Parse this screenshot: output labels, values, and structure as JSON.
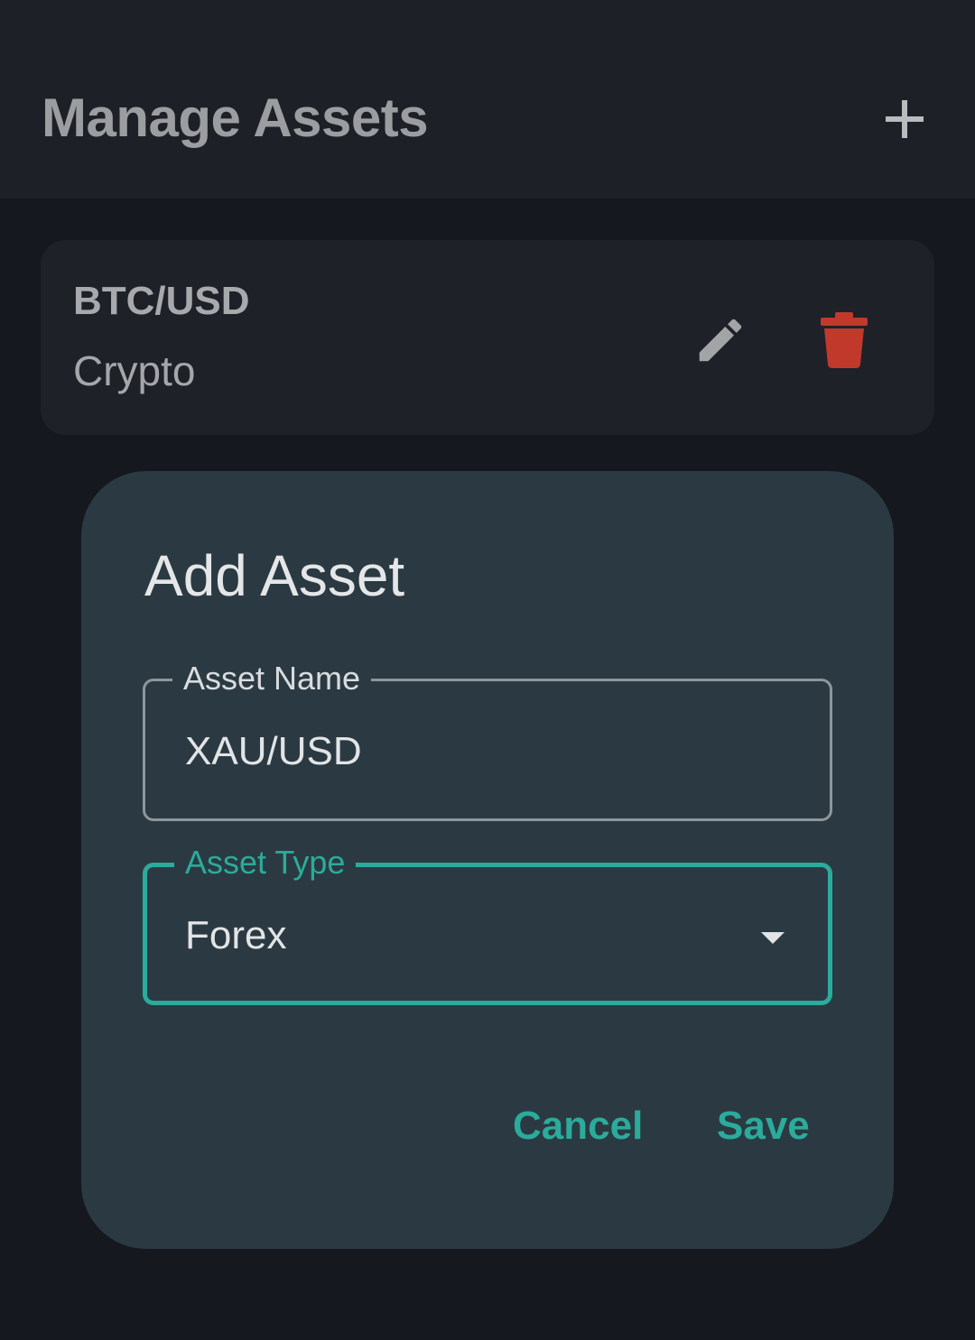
{
  "header": {
    "title": "Manage Assets",
    "add_icon": "plus-icon"
  },
  "assets": [
    {
      "name": "BTC/USD",
      "type": "Crypto",
      "edit_icon": "pencil-icon",
      "delete_icon": "trash-icon"
    }
  ],
  "dialog": {
    "title": "Add Asset",
    "asset_name": {
      "label": "Asset Name",
      "value": "XAU/USD"
    },
    "asset_type": {
      "label": "Asset Type",
      "value": "Forex",
      "icon": "dropdown-arrow-icon"
    },
    "cancel_label": "Cancel",
    "save_label": "Save"
  },
  "colors": {
    "background": "#15181e",
    "appbar": "#1d2027",
    "card": "#1e2128",
    "dialog": "#2b3a42",
    "accent": "#2bab9b",
    "delete": "#c0392b"
  }
}
